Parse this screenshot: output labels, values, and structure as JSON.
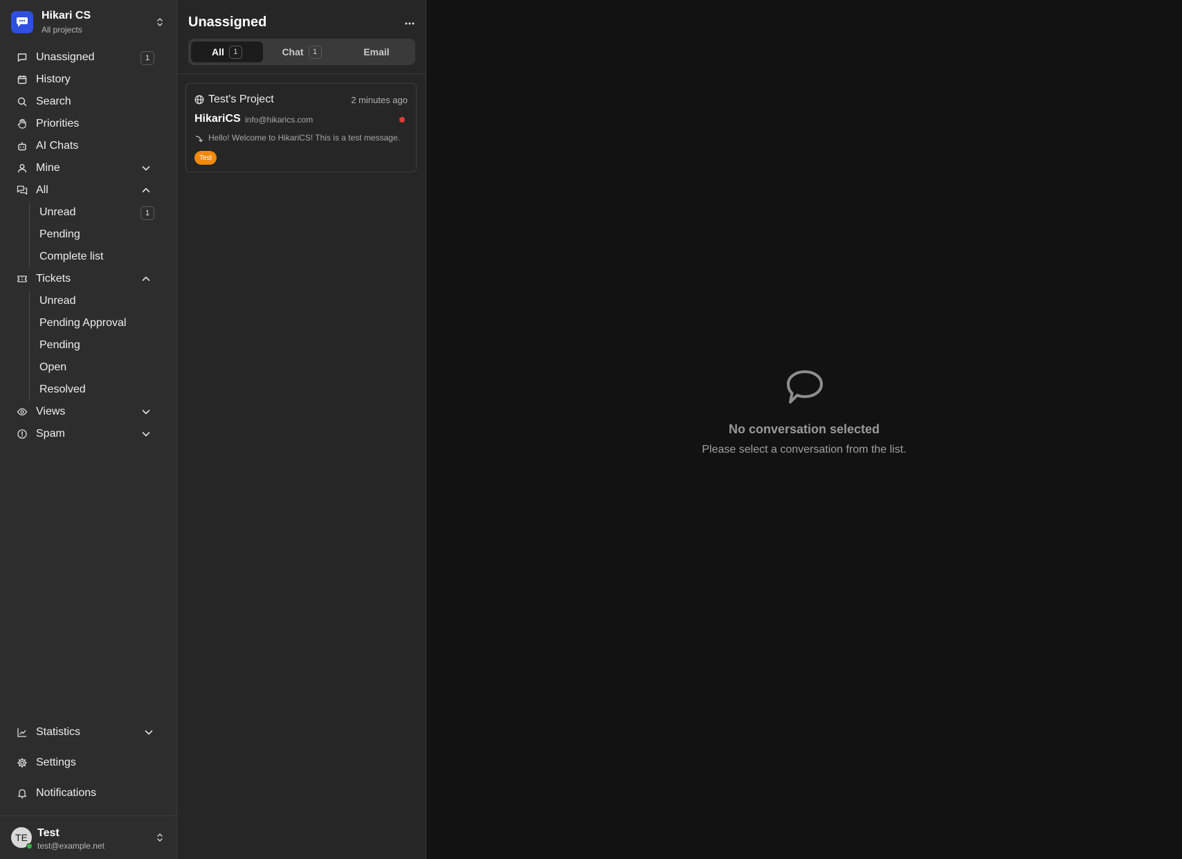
{
  "brand": {
    "name": "Hikari CS",
    "subtitle": "All projects"
  },
  "nav": {
    "unassigned": {
      "label": "Unassigned",
      "badge": "1"
    },
    "history": {
      "label": "History"
    },
    "search": {
      "label": "Search"
    },
    "priorities": {
      "label": "Priorities"
    },
    "ai_chats": {
      "label": "AI Chats"
    },
    "mine": {
      "label": "Mine"
    },
    "all": {
      "label": "All",
      "items": [
        {
          "label": "Unread",
          "badge": "1"
        },
        {
          "label": "Pending"
        },
        {
          "label": "Complete list"
        }
      ]
    },
    "tickets": {
      "label": "Tickets",
      "items": [
        {
          "label": "Unread"
        },
        {
          "label": "Pending Approval"
        },
        {
          "label": "Pending"
        },
        {
          "label": "Open"
        },
        {
          "label": "Resolved"
        }
      ]
    },
    "views": {
      "label": "Views"
    },
    "spam": {
      "label": "Spam"
    },
    "statistics": {
      "label": "Statistics"
    },
    "settings": {
      "label": "Settings"
    },
    "notifications": {
      "label": "Notifications"
    }
  },
  "user": {
    "initials": "TE",
    "name": "Test",
    "email": "test@example.net",
    "status_color": "#3ab54a"
  },
  "list": {
    "title": "Unassigned",
    "tabs": [
      {
        "label": "All",
        "count": "1",
        "active": true
      },
      {
        "label": "Chat",
        "count": "1"
      },
      {
        "label": "Email"
      }
    ],
    "conversations": [
      {
        "project": "Test's Project",
        "time": "2 minutes ago",
        "name": "HikariCS",
        "email": "info@hikarics.com",
        "preview": "Hello! Welcome to HikariCS! This is a test message.",
        "tag": "Test",
        "unread": true
      }
    ]
  },
  "empty_state": {
    "title": "No conversation selected",
    "subtitle": "Please select a conversation from the list."
  },
  "colors": {
    "brand": "#2f4fe0",
    "tag": "#f08a0c",
    "unread": "#e23b3b"
  }
}
